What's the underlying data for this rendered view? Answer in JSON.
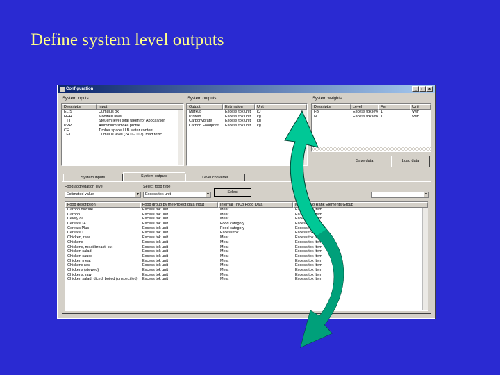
{
  "slide": {
    "title": "Define system level outputs"
  },
  "window": {
    "title": "Configuration",
    "min": "_",
    "max": "□",
    "close": "×"
  },
  "system_inputs": {
    "label": "System inputs",
    "columns": [
      "Descriptor",
      "Input"
    ],
    "rows": [
      [
        "ELIS",
        "Cumulus ok"
      ],
      [
        "HEH",
        "Modified level"
      ],
      [
        "TTT",
        "Steuem level total taken for Apocalyson"
      ],
      [
        "PPP",
        "Aluminium smoke profile"
      ],
      [
        "CE",
        "Timber space / LB water content"
      ],
      [
        "TFT",
        "Cumulus level (24.0 - 107), mad toxic"
      ]
    ]
  },
  "system_outputs": {
    "label": "System outputs",
    "columns": [
      "Output",
      "Estimation",
      "Unit"
    ],
    "rows": [
      [
        "Markup",
        "Excess tok unit",
        "kJ"
      ],
      [
        "Protein",
        "Excess tok unit",
        "kg"
      ],
      [
        "Carbohydrate",
        "Excess tok unit",
        "kg"
      ],
      [
        "Carbon Foodprint",
        "Excess tok unit",
        "kg"
      ]
    ]
  },
  "system_weights": {
    "label": "System weights",
    "columns": [
      "Descriptor",
      "Level",
      "Fer",
      "Unit"
    ],
    "rows": [
      [
        "FB",
        "Excess tok level",
        "1",
        "Wm"
      ],
      [
        "NL",
        "Excess tok level",
        "1",
        "Wm"
      ]
    ]
  },
  "buttons": {
    "save": "Save data",
    "load": "Load data",
    "select": "Select"
  },
  "tabs": [
    "System inputs",
    "System outputs",
    "Level converter"
  ],
  "filters": {
    "aggregation_label": "Food aggregation level",
    "aggregation_value": "Estimated value",
    "type_label": "Select food type",
    "type_value": "Excess tok unit"
  },
  "food_table": {
    "columns": [
      "Food description",
      "Food group by the Project data input",
      "Internal TinCo Food Data",
      "Mark TinCo Rank Elements Group"
    ],
    "rows": [
      [
        "Carbon dioxide",
        "Excess tok unit",
        "Meat",
        "Excess tok Item"
      ],
      [
        "Carbon",
        "Excess tok unit",
        "Meat",
        "Excess tok Item"
      ],
      [
        "Celery oil",
        "Excess tok unit",
        "Meat",
        "Excess tok Item"
      ],
      [
        "Cereals 141",
        "Excess tok unit",
        "Food category",
        "Excess tok Item"
      ],
      [
        "Cereals Plus",
        "Excess tok unit",
        "Food category",
        "Excess tok Item"
      ],
      [
        "Cereals TT",
        "Excess tok unit",
        "Excess tok",
        "Excess tok Item"
      ],
      [
        "Chicken, raw",
        "Excess tok unit",
        "Meat",
        "Excess tok Item"
      ],
      [
        "Chickens",
        "Excess tok unit",
        "Meat",
        "Excess tok Item"
      ],
      [
        "Chickens, meat breast, cut",
        "Excess tok unit",
        "Meat",
        "Excess tok Item"
      ],
      [
        "Chicken salad",
        "Excess tok unit",
        "Meat",
        "Excess tok Item"
      ],
      [
        "Chicken sauce",
        "Excess tok unit",
        "Meat",
        "Excess tok Item"
      ],
      [
        "Chicken meat",
        "Excess tok unit",
        "Meat",
        "Excess tok Item"
      ],
      [
        "Chickens raw",
        "Excess tok unit",
        "Meat",
        "Excess tok Item"
      ],
      [
        "Chickens (stewed)",
        "Excess tok unit",
        "Meat",
        "Excess tok Item"
      ],
      [
        "Chickens, raw",
        "Excess tok unit",
        "Meat",
        "Excess tok Item"
      ],
      [
        "Chicken salad, diced, boiled (unspecified)",
        "Excess tok unit",
        "Meat",
        "Excess tok Item"
      ]
    ]
  },
  "colors": {
    "slide_bg": "#2a2ad2",
    "title": "#ffff88",
    "arrow_fill": "#00c896",
    "arrow_shade": "#00a07a"
  },
  "arrow": {
    "icon": "curved-arrow-icon"
  }
}
